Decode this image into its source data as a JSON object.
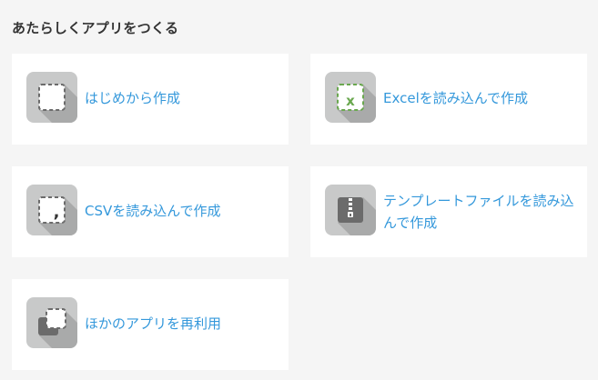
{
  "page": {
    "title": "あたらしくアプリをつくる"
  },
  "options": [
    {
      "label": "はじめから作成",
      "icon": "blank-page-icon"
    },
    {
      "label": "Excelを読み込んで作成",
      "icon": "excel-file-icon"
    },
    {
      "label": "CSVを読み込んで作成",
      "icon": "csv-file-icon"
    },
    {
      "label": "テンプレートファイルを読み込んで作成",
      "icon": "zip-template-icon"
    },
    {
      "label": "ほかのアプリを再利用",
      "icon": "reuse-app-icon"
    }
  ],
  "colors": {
    "link": "#3498db",
    "icon_tile": "#c8c9c9",
    "icon_shadow": "#a9aaaa",
    "excel_green": "#6aa84f",
    "dark_icon": "#6b6b6b",
    "background": "#f5f5f5"
  }
}
